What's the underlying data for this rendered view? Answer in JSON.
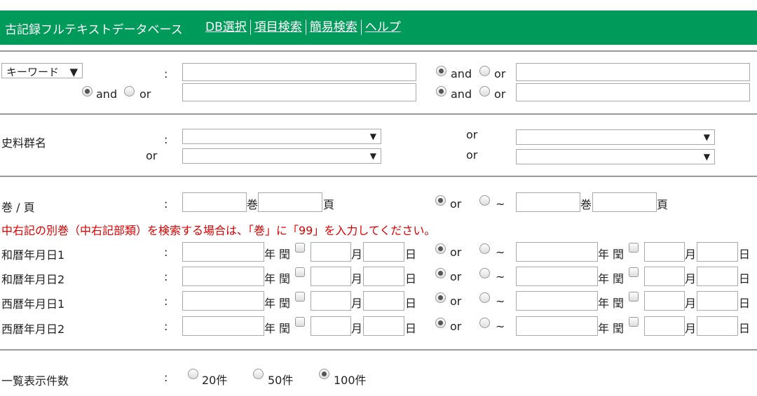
{
  "header": {
    "title": "古記録フルテキストデータベース",
    "nav": [
      "DB選択",
      "項目検索",
      "簡易検索",
      "ヘルプ"
    ]
  },
  "colon": ":",
  "keyword": {
    "select_value": "キーワード",
    "and": "and",
    "or": "or"
  },
  "shiryo": {
    "label": "史料群名",
    "or": "or"
  },
  "kan": {
    "label": "巻 / 頁",
    "kan": "巻",
    "page": "頁",
    "or": "or",
    "range": "~",
    "note": "中右記の別巻（中右記部類）を検索する場合は、「巻」に「99」を入力してください。"
  },
  "dates": {
    "rows": [
      "和暦年月日1",
      "和暦年月日2",
      "西暦年月日1",
      "西暦年月日2"
    ],
    "year": "年",
    "leap": "閏",
    "month": "月",
    "day": "日",
    "or": "or",
    "range": "~"
  },
  "list": {
    "label": "一覧表示件数",
    "options": [
      "20件",
      "50件",
      "100件"
    ],
    "selected": "100件"
  },
  "select_arrow": "▼"
}
